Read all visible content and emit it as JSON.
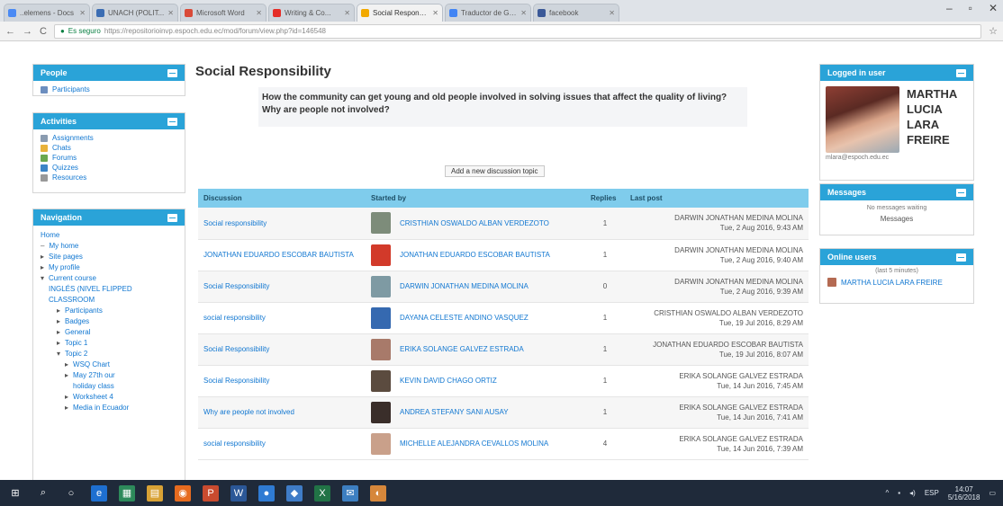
{
  "browser": {
    "tabs": [
      {
        "title": "..elemens - Docs",
        "color": "#4a8af4"
      },
      {
        "title": "UNACH (POLIT...",
        "color": "#3b6db3"
      },
      {
        "title": "Microsoft Word",
        "color": "#d94a38"
      },
      {
        "title": "Writing & Co...",
        "color": "#e52d27"
      },
      {
        "title": "Social Responsib...",
        "color": "#f2a900"
      },
      {
        "title": "Traductor de Go...",
        "color": "#4285f4"
      },
      {
        "title": "facebook",
        "color": "#3b5998"
      }
    ],
    "active_tab_index": 4,
    "url_secure_label": "Es seguro",
    "url": "https://repositorioinvp.espoch.edu.ec/mod/forum/view.php?id=146548"
  },
  "page_title": "Social Responsibility",
  "intro": "How the community can get young and old people involved in solving issues that affect the quality of living? Why are people not involved?",
  "add_topic_label": "Add a new discussion topic",
  "left": {
    "people": {
      "header": "People",
      "items": [
        {
          "label": "Participants",
          "color": "#6c8ebf"
        }
      ]
    },
    "activities": {
      "header": "Activities",
      "items": [
        {
          "label": "Assignments",
          "color": "#8a9bb0"
        },
        {
          "label": "Chats",
          "color": "#e8b23a"
        },
        {
          "label": "Forums",
          "color": "#6aa84f"
        },
        {
          "label": "Quizzes",
          "color": "#3d85c6"
        },
        {
          "label": "Resources",
          "color": "#999999"
        }
      ]
    },
    "navigation": {
      "header": "Navigation",
      "items": [
        {
          "label": "Home",
          "indent": 0,
          "bullet": ""
        },
        {
          "label": "My home",
          "indent": 0,
          "bullet": "–"
        },
        {
          "label": "Site pages",
          "indent": 0,
          "bullet": "▸"
        },
        {
          "label": "My profile",
          "indent": 0,
          "bullet": "▸"
        },
        {
          "label": "Current course",
          "indent": 0,
          "bullet": "▾"
        },
        {
          "label": "INGLÉS (NIVEL FLIPPED",
          "indent": 1,
          "bullet": ""
        },
        {
          "label": "CLASSROOM",
          "indent": 1,
          "bullet": ""
        },
        {
          "label": "Participants",
          "indent": 2,
          "bullet": "▸"
        },
        {
          "label": "Badges",
          "indent": 2,
          "bullet": "▸"
        },
        {
          "label": "General",
          "indent": 2,
          "bullet": "▸"
        },
        {
          "label": "Topic 1",
          "indent": 2,
          "bullet": "▸"
        },
        {
          "label": "Topic 2",
          "indent": 2,
          "bullet": "▾"
        },
        {
          "label": "WSQ Chart",
          "indent": 3,
          "bullet": "▸"
        },
        {
          "label": "May 27th our",
          "indent": 3,
          "bullet": "▸"
        },
        {
          "label": "holiday class",
          "indent": 4,
          "bullet": ""
        },
        {
          "label": "Worksheet 4",
          "indent": 3,
          "bullet": "▸"
        },
        {
          "label": "Media in Ecuador",
          "indent": 3,
          "bullet": "▸"
        }
      ]
    }
  },
  "table": {
    "headers": {
      "discussion": "Discussion",
      "started_by": "Started by",
      "replies": "Replies",
      "last_post": "Last post"
    },
    "rows": [
      {
        "discussion": "Social responsibility",
        "started_by": "CRISTHIAN OSWALDO ALBAN VERDEZOTO",
        "replies": "1",
        "last_by": "DARWIN JONATHAN MEDINA MOLINA",
        "last_date": "Tue, 2 Aug 2016, 9:43 AM",
        "avatar": "#7d8c7a"
      },
      {
        "discussion": "JONATHAN EDUARDO ESCOBAR BAUTISTA",
        "started_by": "JONATHAN EDUARDO ESCOBAR BAUTISTA",
        "replies": "1",
        "last_by": "DARWIN JONATHAN MEDINA MOLINA",
        "last_date": "Tue, 2 Aug 2016, 9:40 AM",
        "avatar": "#d23a2a"
      },
      {
        "discussion": "Social Responsibility",
        "started_by": "DARWIN JONATHAN MEDINA MOLINA",
        "replies": "0",
        "last_by": "DARWIN JONATHAN MEDINA MOLINA",
        "last_date": "Tue, 2 Aug 2016, 9:39 AM",
        "avatar": "#7e9aa3"
      },
      {
        "discussion": "social responsibility",
        "started_by": "DAYANA CELESTE ANDINO VASQUEZ",
        "replies": "1",
        "last_by": "CRISTHIAN OSWALDO ALBAN VERDEZOTO",
        "last_date": "Tue, 19 Jul 2016, 8:29 AM",
        "avatar": "#3569b0"
      },
      {
        "discussion": "Social Responsibility",
        "started_by": "ERIKA SOLANGE GALVEZ ESTRADA",
        "replies": "1",
        "last_by": "JONATHAN EDUARDO ESCOBAR BAUTISTA",
        "last_date": "Tue, 19 Jul 2016, 8:07 AM",
        "avatar": "#a87a6a"
      },
      {
        "discussion": "Social Responsibility",
        "started_by": "KEVIN DAVID CHAGO ORTIZ",
        "replies": "1",
        "last_by": "ERIKA SOLANGE GALVEZ ESTRADA",
        "last_date": "Tue, 14 Jun 2016, 7:45 AM",
        "avatar": "#5b4b3f"
      },
      {
        "discussion": "Why are people not involved",
        "started_by": "ANDREA STEFANY SANI AUSAY",
        "replies": "1",
        "last_by": "ERIKA SOLANGE GALVEZ ESTRADA",
        "last_date": "Tue, 14 Jun 2016, 7:41 AM",
        "avatar": "#3a2e2a"
      },
      {
        "discussion": "social responsibility",
        "started_by": "MICHELLE ALEJANDRA CEVALLOS MOLINA",
        "replies": "4",
        "last_by": "ERIKA SOLANGE GALVEZ ESTRADA",
        "last_date": "Tue, 14 Jun 2016, 7:39 AM",
        "avatar": "#c9a08a"
      }
    ]
  },
  "right": {
    "logged_in": {
      "header": "Logged in user",
      "name_lines": [
        "MARTHA",
        "LUCIA",
        "LARA",
        "FREIRE"
      ],
      "email": "mlara@espoch.edu.ec"
    },
    "messages": {
      "header": "Messages",
      "text": "No messages waiting",
      "link": "Messages"
    },
    "online_users": {
      "header": "Online users",
      "subtitle": "(last 5 minutes)",
      "user": "MARTHA LUCIA LARA FREIRE"
    }
  },
  "taskbar": {
    "icons": [
      {
        "name": "start-icon",
        "glyph": "⊞",
        "color": "#1f2a3a"
      },
      {
        "name": "search-icon",
        "glyph": "⌕",
        "color": "#1f2a3a"
      },
      {
        "name": "cortana-icon",
        "glyph": "○",
        "color": "#1f2a3a"
      },
      {
        "name": "edge-icon",
        "glyph": "e",
        "color": "#1e6fd0"
      },
      {
        "name": "store-icon",
        "glyph": "▦",
        "color": "#2d8a5b"
      },
      {
        "name": "file-explorer-icon",
        "glyph": "▤",
        "color": "#d8a235"
      },
      {
        "name": "firefox-icon",
        "glyph": "◉",
        "color": "#e66b1f"
      },
      {
        "name": "powerpoint-icon",
        "glyph": "P",
        "color": "#c94b2f"
      },
      {
        "name": "word-icon",
        "glyph": "W",
        "color": "#2b5797"
      },
      {
        "name": "chrome-icon",
        "glyph": "●",
        "color": "#2f7bd3"
      },
      {
        "name": "shield-icon",
        "glyph": "◆",
        "color": "#3f7cc7"
      },
      {
        "name": "excel-icon",
        "glyph": "X",
        "color": "#217346"
      },
      {
        "name": "mail-icon",
        "glyph": "✉",
        "color": "#3d7fc1"
      },
      {
        "name": "app-icon",
        "glyph": "◐",
        "color": "#d6873b"
      }
    ],
    "time": "14:07",
    "date": "5/16/2018",
    "lang": "ESP"
  }
}
